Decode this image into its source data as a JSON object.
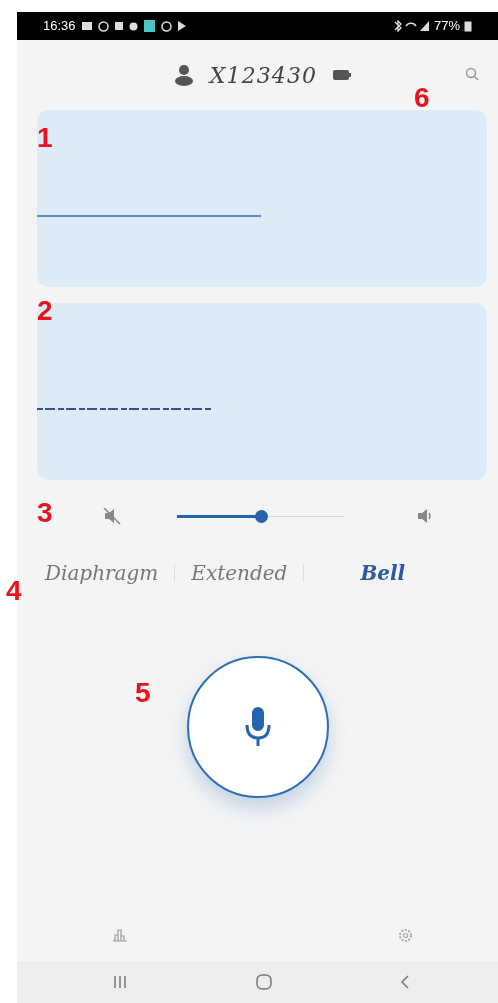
{
  "status_bar": {
    "time": "16:36",
    "battery": "77%"
  },
  "header": {
    "device_id": "X123430"
  },
  "annotations": [
    "1",
    "2",
    "3",
    "4",
    "5",
    "6"
  ],
  "volume": {
    "level": 0.5
  },
  "filters": [
    {
      "label": "Diaphragm",
      "selected": false
    },
    {
      "label": "Extended",
      "selected": false
    },
    {
      "label": "Bell",
      "selected": true
    }
  ]
}
